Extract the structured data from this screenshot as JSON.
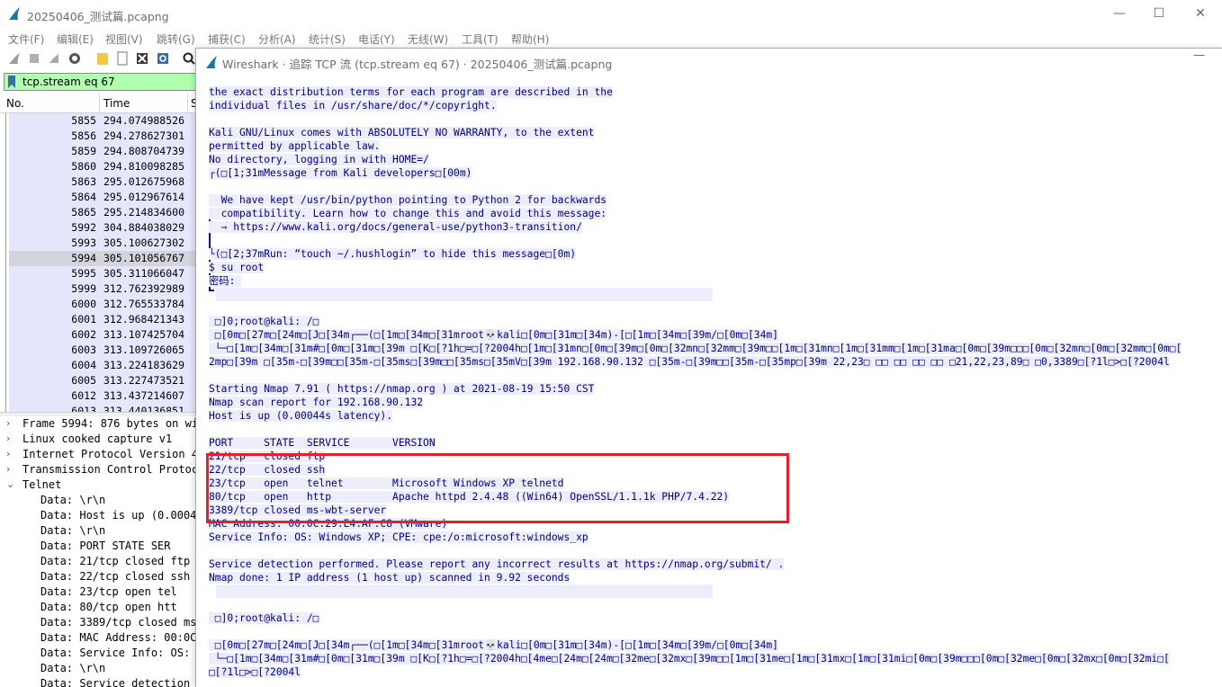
{
  "main": {
    "title": "20250406_测试篇.pcapng",
    "minimize": "—",
    "maximize": "☐",
    "close": "✕"
  },
  "menu": [
    "文件(F)",
    "编辑(E)",
    "视图(V)",
    "跳转(G)",
    "捕获(C)",
    "分析(A)",
    "统计(S)",
    "电话(Y)",
    "无线(W)",
    "工具(T)",
    "帮助(H)"
  ],
  "filter": {
    "text": "tcp.stream eq 67"
  },
  "packet_list": {
    "headers": {
      "no": "No.",
      "time": "Time",
      "source": "S"
    },
    "rows": [
      {
        "no": "5855",
        "time": "294.074988526"
      },
      {
        "no": "5856",
        "time": "294.278627301"
      },
      {
        "no": "5859",
        "time": "294.808704739"
      },
      {
        "no": "5860",
        "time": "294.810098285"
      },
      {
        "no": "5863",
        "time": "295.012675968"
      },
      {
        "no": "5864",
        "time": "295.012967614"
      },
      {
        "no": "5865",
        "time": "295.214834600"
      },
      {
        "no": "5992",
        "time": "304.884038029"
      },
      {
        "no": "5993",
        "time": "305.100627302"
      },
      {
        "no": "5994",
        "time": "305.101056767"
      },
      {
        "no": "5995",
        "time": "305.311066047"
      },
      {
        "no": "5999",
        "time": "312.762392989"
      },
      {
        "no": "6000",
        "time": "312.765533784"
      },
      {
        "no": "6001",
        "time": "312.968421343"
      },
      {
        "no": "6002",
        "time": "313.107425704"
      },
      {
        "no": "6003",
        "time": "313.109726065"
      },
      {
        "no": "6004",
        "time": "313.224183629"
      },
      {
        "no": "6005",
        "time": "313.227473521"
      },
      {
        "no": "6012",
        "time": "313.437214607"
      },
      {
        "no": "6013",
        "time": "313.440136851"
      }
    ],
    "selected_index": 9
  },
  "details": [
    {
      "arrow": "›",
      "text": "Frame 5994: 876 bytes on wi",
      "indent": 0
    },
    {
      "arrow": "›",
      "text": "Linux cooked capture v1",
      "indent": 0
    },
    {
      "arrow": "›",
      "text": "Internet Protocol Version 4,",
      "indent": 0
    },
    {
      "arrow": "›",
      "text": "Transmission Control Protoco",
      "indent": 0
    },
    {
      "arrow": "⌄",
      "text": "Telnet",
      "indent": 0
    },
    {
      "arrow": "",
      "text": "Data: \\r\\n",
      "indent": 1
    },
    {
      "arrow": "",
      "text": "Data: Host is up (0.00044",
      "indent": 1
    },
    {
      "arrow": "",
      "text": "Data: \\r\\n",
      "indent": 1
    },
    {
      "arrow": "",
      "text": "Data: PORT     STATE  SER",
      "indent": 1
    },
    {
      "arrow": "",
      "text": "Data: 21/tcp   closed ftp",
      "indent": 1
    },
    {
      "arrow": "",
      "text": "Data: 22/tcp   closed ssh",
      "indent": 1
    },
    {
      "arrow": "",
      "text": "Data: 23/tcp   open   tel",
      "indent": 1
    },
    {
      "arrow": "",
      "text": "Data: 80/tcp   open   htt",
      "indent": 1
    },
    {
      "arrow": "",
      "text": "Data: 3389/tcp closed ms-",
      "indent": 1
    },
    {
      "arrow": "",
      "text": "Data: MAC Address: 00:0C:",
      "indent": 1
    },
    {
      "arrow": "",
      "text": "Data: Service Info: OS: W",
      "indent": 1
    },
    {
      "arrow": "",
      "text": "Data: \\r\\n",
      "indent": 1
    },
    {
      "arrow": "",
      "text": "Data: Service detection",
      "indent": 1
    }
  ],
  "dialog": {
    "title": "Wireshark · 追踪 TCP 流 (tcp.stream eq 67) · 20250406_测试篇.pcapng",
    "minimize": "—",
    "stream_lines": [
      {
        "text": "the exact distribution terms for each program are described in the",
        "kind": "srv"
      },
      {
        "text": "individual files in /usr/share/doc/*/copyright.",
        "kind": "srv"
      },
      {
        "text": "",
        "kind": "gap"
      },
      {
        "text": "Kali GNU/Linux comes with ABSOLUTELY NO WARRANTY, to the extent",
        "kind": "srv"
      },
      {
        "text": "permitted by applicable law.",
        "kind": "srv"
      },
      {
        "text": "No directory, logging in with HOME=/",
        "kind": "srv"
      },
      {
        "text": "┌(□[1;31mMessage from Kali developers□[00m)",
        "kind": "srv"
      },
      {
        "text": "",
        "kind": "gap"
      },
      {
        "text": "  We have kept /usr/bin/python pointing to Python 2 for backwards",
        "kind": "srv"
      },
      {
        "text": "  compatibility. Learn how to change this and avoid this message:",
        "kind": "srv"
      },
      {
        "text": "  ⇒ https://www.kali.org/docs/general-use/python3-transition/",
        "kind": "srv"
      },
      {
        "text": "",
        "kind": "gap"
      },
      {
        "text": "└(□[2;37mRun: “touch ~/.hushlogin” to hide this message□[0m)",
        "kind": "srv"
      },
      {
        "text": "$ su root",
        "kind": "srv"
      },
      {
        "text": "密码: ",
        "kind": "srv"
      },
      {
        "text": "",
        "kind": "blank"
      },
      {
        "text": "",
        "kind": "gap"
      },
      {
        "text": " □]0;root@kali: /□",
        "kind": "srv"
      },
      {
        "text": " □[0m□[27m□[24m□[J□[34m┌──(□[1m□[34m□[31mroot💀kali□[0m□[31m□[34m)-[□[1m□[34m□[39m/□[0m□[34m]",
        "kind": "srv"
      },
      {
        "text": " └─□[1m□[34m□[31m#□[0m□[31m□[39m □[K□[?1h□=□[?2004h□[1m□[31mn□[0m□[39m□[0m□[32mn□[32mm□[39m□□[1m□[31mn□[1m□[31mm□[1m□[31ma□[0m□[39m□□□[0m□[32mn□[0m□[32mm□[0m□[",
        "kind": "srv"
      },
      {
        "text": "2mp□[39m □[35m-□[39m□□[35m-□[35ms□[39m□□[35ms□[35mV□[39m 192.168.90.132 □[35m-□[39m□□[35m-□[35mp□[39m 22,23□ □□ □□ □□ □□ □21,22,23,89□ □0,3389□[?1l□>□[?2004l",
        "kind": "srv"
      },
      {
        "text": "",
        "kind": "gap"
      },
      {
        "text": "Starting Nmap 7.91 ( https://nmap.org ) at 2021-08-19 15:50 CST",
        "kind": "srv"
      },
      {
        "text": "Nmap scan report for 192.168.90.132",
        "kind": "srv"
      },
      {
        "text": "Host is up (0.00044s latency).",
        "kind": "srv"
      },
      {
        "text": "",
        "kind": "gap"
      },
      {
        "text": "PORT     STATE  SERVICE       VERSION",
        "kind": "srv"
      },
      {
        "text": "21/tcp   closed ftp",
        "kind": "srv"
      },
      {
        "text": "22/tcp   closed ssh",
        "kind": "srv"
      },
      {
        "text": "23/tcp   open   telnet        Microsoft Windows XP telnetd",
        "kind": "srv"
      },
      {
        "text": "80/tcp   open   http          Apache httpd 2.4.48 ((Win64) OpenSSL/1.1.1k PHP/7.4.22)",
        "kind": "srv"
      },
      {
        "text": "3389/tcp closed ms-wbt-server",
        "kind": "srv"
      },
      {
        "text": "MAC Address: 00:0C:29:E4:AF:C8 (VMware)",
        "kind": "srv"
      },
      {
        "text": "Service Info: OS: Windows XP; CPE: cpe:/o:microsoft:windows_xp",
        "kind": "srv"
      },
      {
        "text": "",
        "kind": "gap"
      },
      {
        "text": "Service detection performed. Please report any incorrect results at https://nmap.org/submit/ .",
        "kind": "srv"
      },
      {
        "text": "Nmap done: 1 IP address (1 host up) scanned in 9.92 seconds",
        "kind": "srv"
      },
      {
        "text": "",
        "kind": "blank"
      },
      {
        "text": "",
        "kind": "gap"
      },
      {
        "text": " □]0;root@kali: /□",
        "kind": "srv"
      },
      {
        "text": "",
        "kind": "gap"
      },
      {
        "text": " □[0m□[27m□[24m□[J□[34m┌──(□[1m□[34m□[31mroot💀kali□[0m□[31m□[34m)-[□[1m□[34m□[39m/□[0m□[34m]",
        "kind": "srv"
      },
      {
        "text": " └─□[1m□[34m□[31m#□[0m□[31m□[39m □[K□[?1h□=□[?2004h□[4me□[24m□[24m□[32me□[32mx□[39m□□[1m□[31me□[1m□[31mx□[1m□[31mi□[0m□[39m□□□[0m□[32me□[0m□[32mx□[0m□[32mi□[",
        "kind": "srv"
      },
      {
        "text": "□[?1l□>□[?2004l",
        "kind": "srv"
      }
    ]
  },
  "colors": {
    "filter_bg": "#afffaf",
    "stream_text": "#00007f",
    "stream_bg": "#ededfb",
    "packet_row_bg": "#e6e6fc",
    "packet_row_selected": "#d4d4dc",
    "highlight_box": "#e5202a"
  }
}
